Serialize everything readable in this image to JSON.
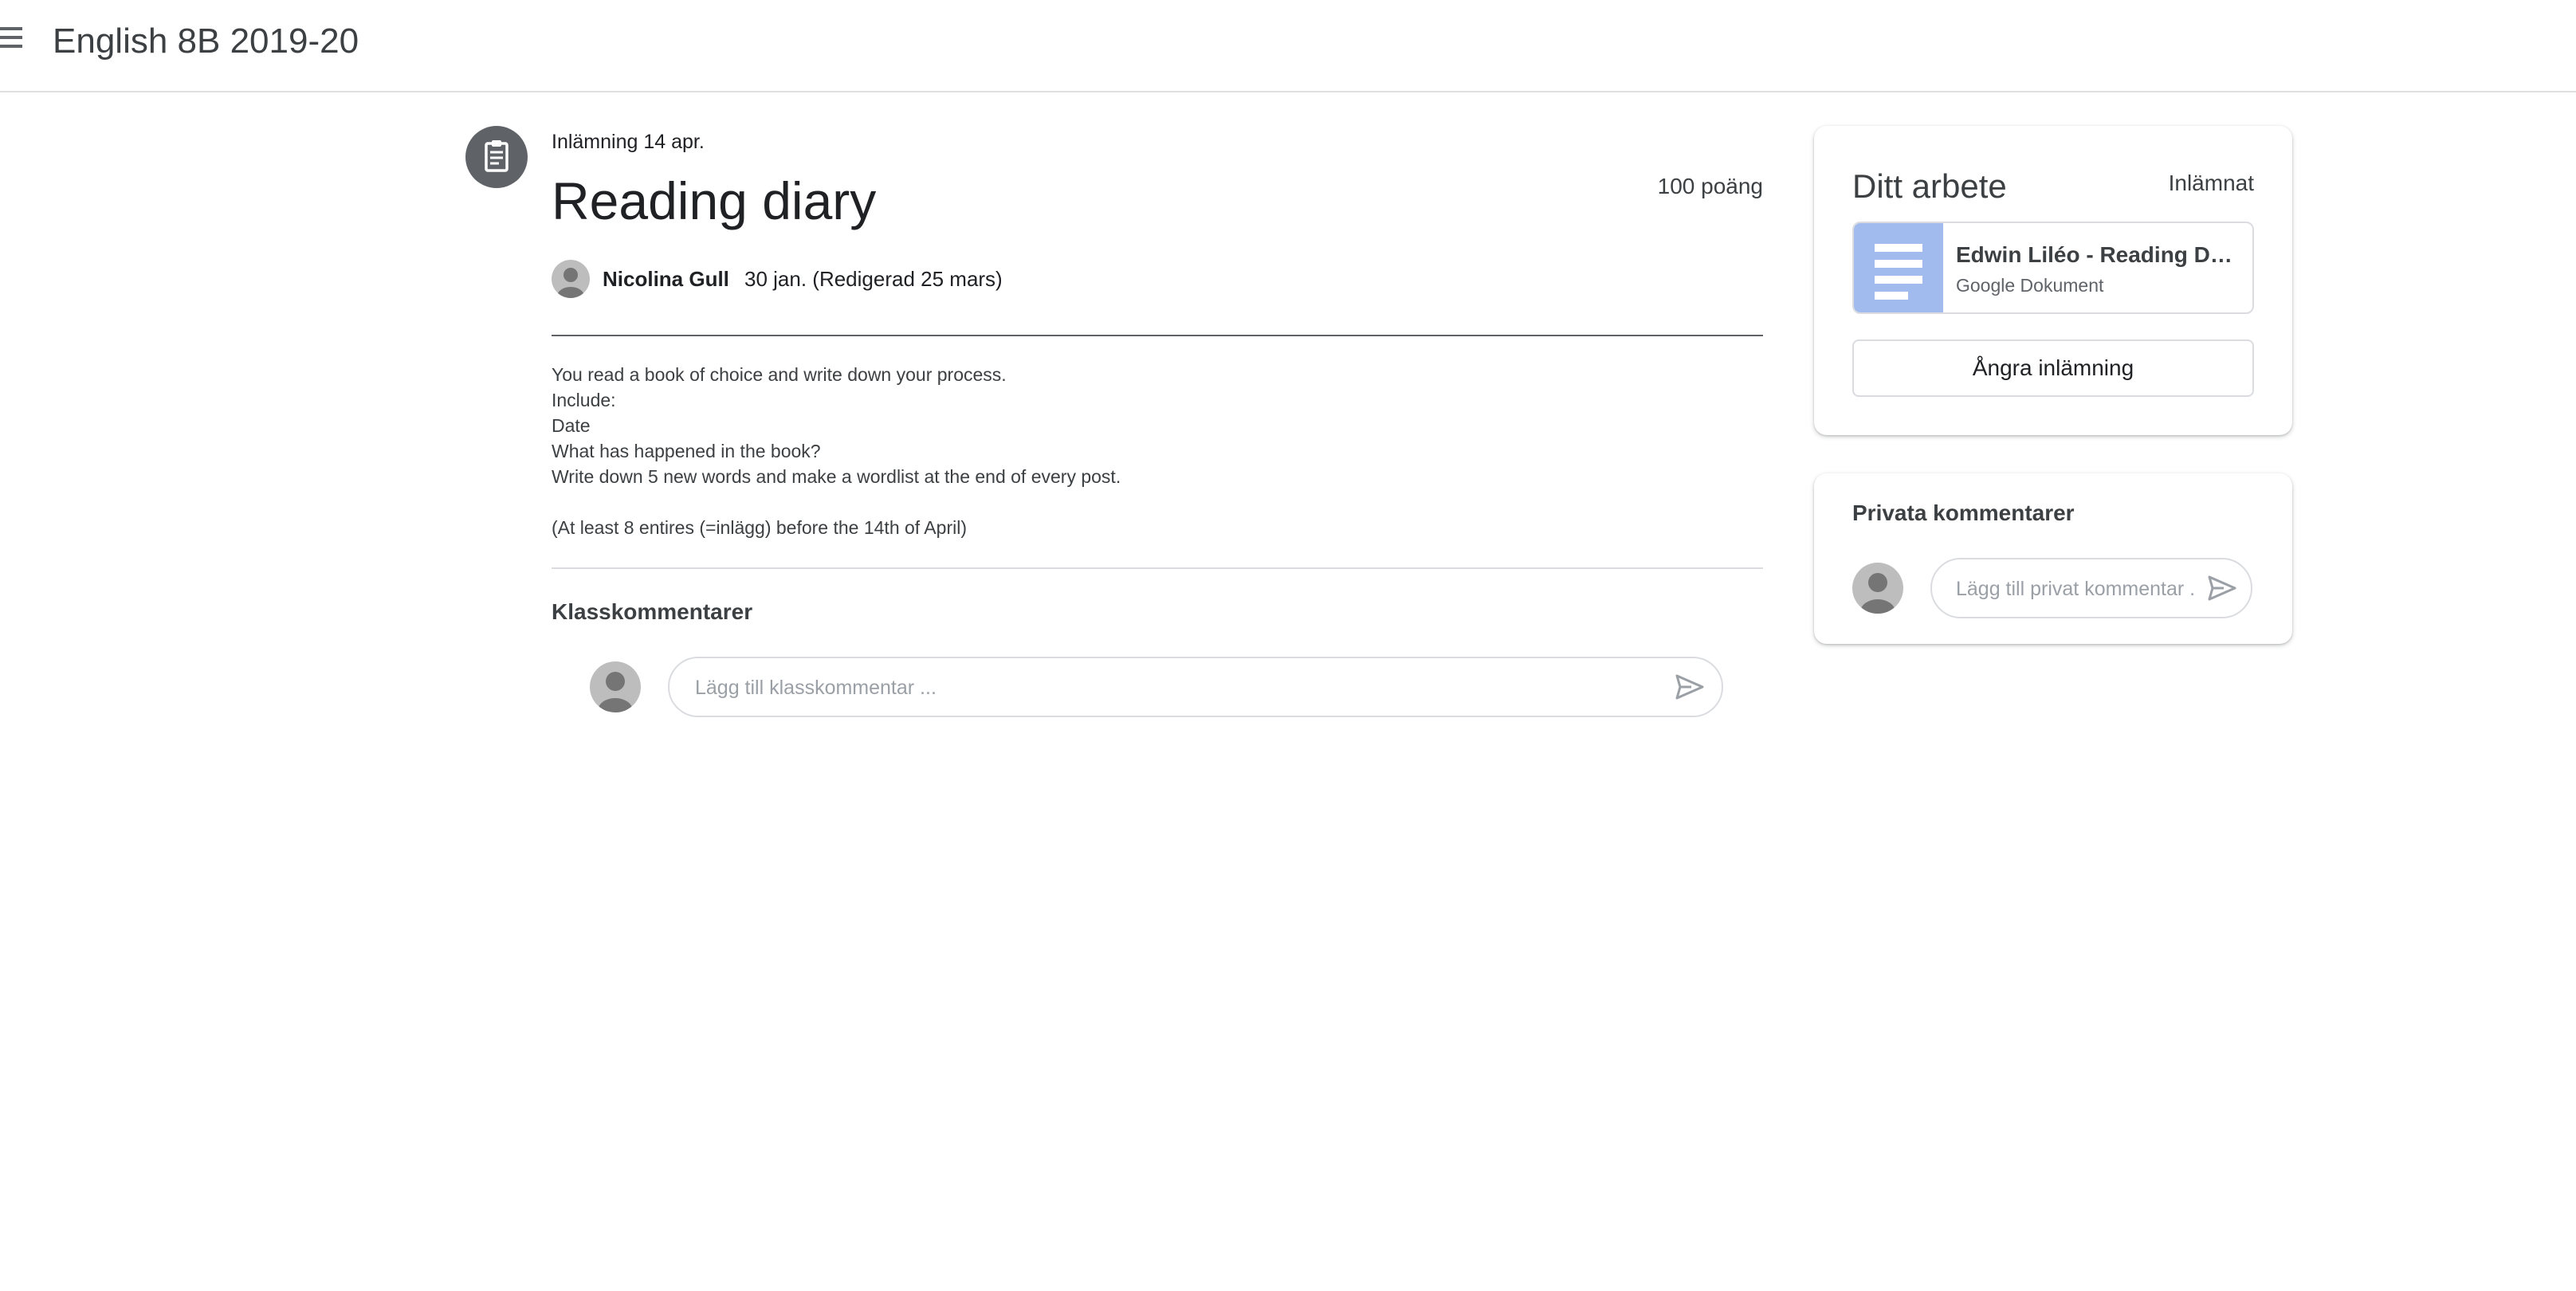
{
  "header": {
    "class_title": "English 8B 2019-20",
    "menu_icon": "hamburger-menu-icon"
  },
  "assignment": {
    "icon": "assignment-clipboard-icon",
    "due": "Inlämning 14 apr.",
    "title": "Reading diary",
    "points": "100 poäng",
    "author": "Nicolina Gull",
    "posted": "30 jan. (Redigerad 25 mars)",
    "description_lines": [
      "You read a book of choice and write down your process.",
      "Include:",
      "Date",
      "What has happened in the book?",
      "Write down 5 new words and make a wordlist at the end of every post.",
      "",
      "(At least 8 entires (=inlägg) before the 14th of April)"
    ]
  },
  "class_comments": {
    "heading": "Klasskommentarer",
    "placeholder": "Lägg till klasskommentar ...",
    "send_icon": "send-icon"
  },
  "your_work": {
    "title": "Ditt arbete",
    "status": "Inlämnat",
    "attachment": {
      "name": "Edwin Liléo - Reading Diary",
      "type": "Google Dokument",
      "icon": "google-docs-icon"
    },
    "unsubmit_label": "Ångra inlämning"
  },
  "private_comments": {
    "title": "Privata kommentarer",
    "placeholder": "Lägg till privat kommentar ...",
    "send_icon": "send-icon"
  },
  "colors": {
    "icon_gray": "#5f6368",
    "divider": "#dadce0",
    "docs_thumb": "#a1bbee",
    "avatar": "#bdbdbd"
  }
}
